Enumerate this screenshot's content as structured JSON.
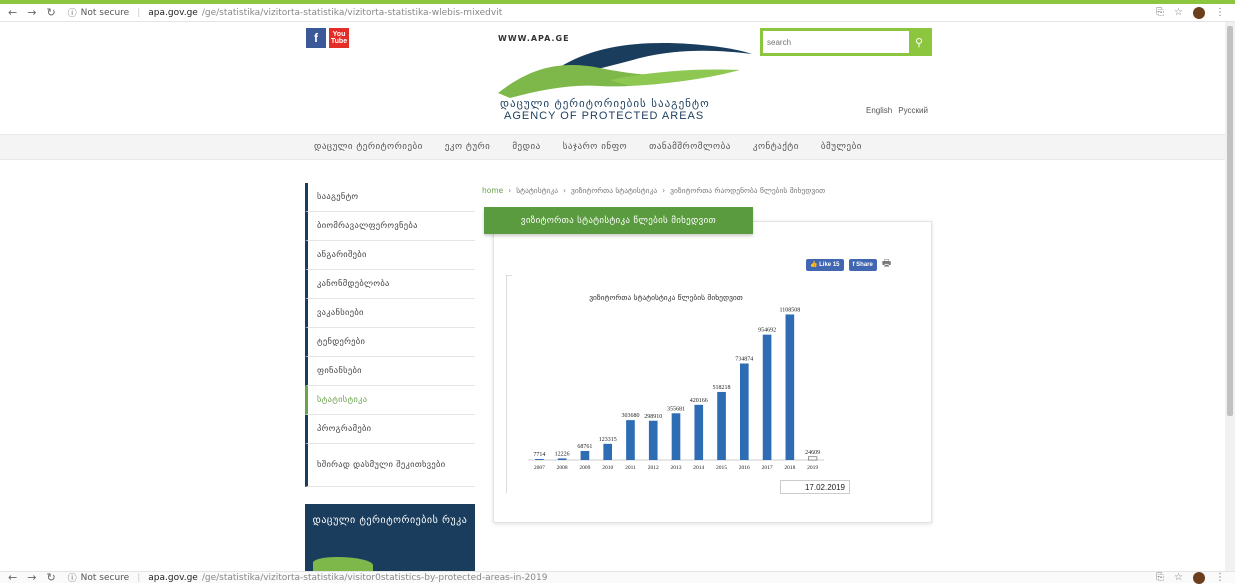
{
  "browser": {
    "top_url_secure": "Not secure",
    "top_url_host": "apa.gov.ge",
    "top_url_path": "/ge/statistika/vizitorta-statistika/vizitorta-statistika-wlebis-mixedvit",
    "bottom_url_secure": "Not secure",
    "bottom_url_host": "apa.gov.ge",
    "bottom_url_path": "/ge/statistika/vizitorta-statistika/visitor0statistics-by-protected-areas-in-2019"
  },
  "header": {
    "site_url": "WWW.APA.GE",
    "agency_geo": "დაცული ტერიტორიების სააგენტო",
    "agency_eng": "AGENCY OF PROTECTED AREAS",
    "search_placeholder": "search",
    "lang_en": "English",
    "lang_ru": "Русский",
    "social_fb": "f",
    "social_yt": "You Tube"
  },
  "nav": [
    "დაცული ტერიტორიები",
    "ეკო ტური",
    "მედია",
    "საჯარო ინფო",
    "თანამშრომლობა",
    "კონტაქტი",
    "ბმულები"
  ],
  "sidebar": {
    "items": [
      {
        "label": "სააგენტო"
      },
      {
        "label": "ბიომრავალფეროვნება"
      },
      {
        "label": "ანგარიშები"
      },
      {
        "label": "კანონმდებლობა"
      },
      {
        "label": "ვაკანსიები"
      },
      {
        "label": "ტენდერები"
      },
      {
        "label": "ფინანსები"
      },
      {
        "label": "სტატისტიკა"
      },
      {
        "label": "პროგრამები"
      },
      {
        "label": "ხშირად დასმული შეკითხვები"
      }
    ],
    "map_title": "დაცული ტერიტორიების რუკა"
  },
  "breadcrumb": {
    "home": "home",
    "sep": "›",
    "c1": "სტატისტიკა",
    "c2": "ვიზიტორთა სტატისტიკა",
    "c3": "ვიზიტორთა რაოდენობა წლების მიხედვით"
  },
  "page": {
    "title": "ვიზიტორთა სტატისტიკა წლების მიხედვით",
    "like_label": "Like 15",
    "share_label": "Share",
    "date": "17.02.2019"
  },
  "chart_data": {
    "type": "bar",
    "title": "ვიზიტორთა სტატისტიკა წლების მიხედვით",
    "categories": [
      "2007",
      "2008",
      "2009",
      "2010",
      "2011",
      "2012",
      "2013",
      "2014",
      "2015",
      "2016",
      "2017",
      "2018",
      "2019"
    ],
    "values": [
      7714,
      12226,
      68761,
      123315,
      303680,
      298910,
      355681,
      420166,
      518218,
      734874,
      954692,
      1108508,
      24609
    ],
    "labels": [
      "7714",
      "12226",
      "68761",
      "123315",
      "303680",
      "298910",
      "355681",
      "420166",
      "518218",
      "734874",
      "954692",
      "1108508",
      "24609"
    ],
    "ylim": [
      0,
      1150000
    ],
    "bar_color": "#2e6db4",
    "xlabel": "",
    "ylabel": ""
  }
}
